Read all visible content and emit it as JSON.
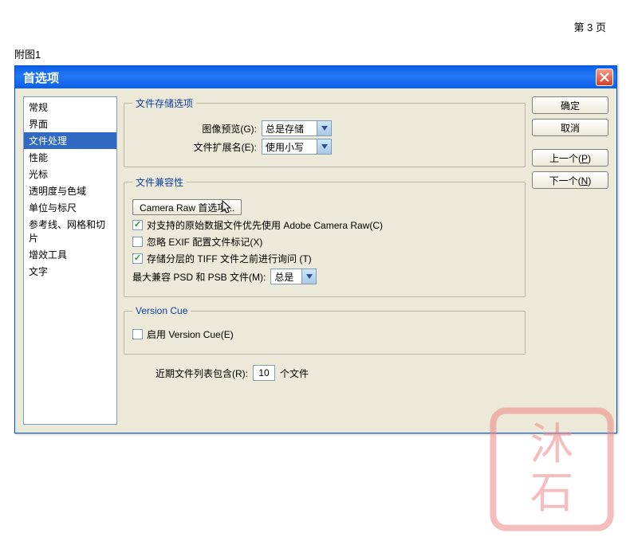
{
  "page": {
    "page_num": "第 3 页",
    "figure_label": "附图1"
  },
  "dialog": {
    "title": "首选项"
  },
  "buttons": {
    "ok": "确定",
    "cancel": "取消",
    "prev": "上一个(P)",
    "next": "下一个(N)"
  },
  "sidebar": {
    "items": [
      {
        "label": "常规"
      },
      {
        "label": "界面"
      },
      {
        "label": "文件处理"
      },
      {
        "label": "性能"
      },
      {
        "label": "光标"
      },
      {
        "label": "透明度与色域"
      },
      {
        "label": "单位与标尺"
      },
      {
        "label": "参考线、网格和切片"
      },
      {
        "label": "增效工具"
      },
      {
        "label": "文字"
      }
    ],
    "selected_index": 2
  },
  "save_options": {
    "legend": "文件存储选项",
    "preview_label": "图像预览(G):",
    "preview_value": "总是存储",
    "ext_label": "文件扩展名(E):",
    "ext_value": "使用小写"
  },
  "compat": {
    "legend": "文件兼容性",
    "camera_btn": "Camera Raw 首选项...",
    "chk1": {
      "label": "对支持的原始数据文件优先使用 Adobe Camera Raw(C)",
      "checked": true
    },
    "chk2": {
      "label": "忽略 EXIF 配置文件标记(X)",
      "checked": false
    },
    "chk3": {
      "label": "存储分层的 TIFF 文件之前进行询问 (T)",
      "checked": true
    },
    "max_label": "最大兼容 PSD 和 PSB 文件(M):",
    "max_value": "总是"
  },
  "vcue": {
    "legend": "Version Cue",
    "chk": {
      "label": "启用 Version Cue(E)",
      "checked": false
    }
  },
  "recent": {
    "label1": "近期文件列表包含(R):",
    "value": "10",
    "label2": "个文件"
  }
}
